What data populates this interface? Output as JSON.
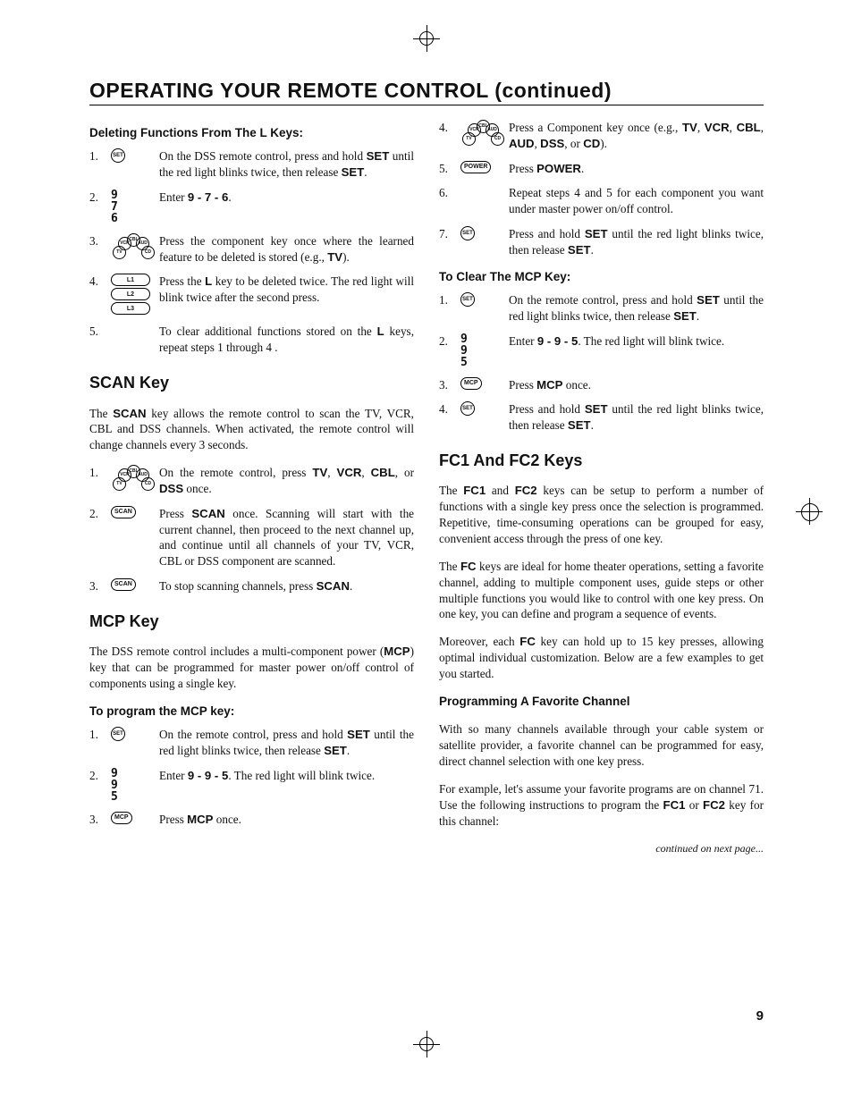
{
  "title": "OPERATING YOUR REMOTE CONTROL (continued)",
  "page_number": "9",
  "continued": "continued on next page...",
  "left": {
    "deleting_head": "Deleting Functions From The L Keys:",
    "del1_num": "1.",
    "del1_icon": "SET",
    "del1_text_a": "On the DSS remote control, press and hold ",
    "del1_text_b": " until the red light blinks twice, then release ",
    "del1_set": "SET",
    "del1_text_c": ".",
    "del2_num": "2.",
    "del2_digits": "9\n7\n6",
    "del2_text_a": "Enter ",
    "del2_code": "9 - 7 - 6",
    "del2_text_b": ".",
    "del3_num": "3.",
    "del3_text_a": "Press the component key once where the learned feature to be deleted is stored (e.g., ",
    "del3_tv": "TV",
    "del3_text_b": ").",
    "del4_num": "4.",
    "del4_l1": "L1",
    "del4_l2": "L2",
    "del4_l3": "L3",
    "del4_text_a": "Press the ",
    "del4_L": "L",
    "del4_text_b": " key to be deleted twice. The red light will blink twice after the second press.",
    "del5_num": "5.",
    "del5_text_a": "To clear additional functions stored on the ",
    "del5_L": "L",
    "del5_text_b": " keys, repeat steps 1 through 4 .",
    "scan_head": "SCAN Key",
    "scan_intro_a": "The ",
    "scan_intro_scan": "SCAN",
    "scan_intro_b": " key allows the remote control to scan the TV, VCR, CBL and DSS channels. When activated, the remote control will change channels every 3 seconds.",
    "scan1_num": "1.",
    "scan1_text_a": "On the remote control, press ",
    "scan1_tv": "TV",
    "scan1_text_b": ", ",
    "scan1_vcr": "VCR",
    "scan1_text_c": ", ",
    "scan1_cbl": "CBL",
    "scan1_text_d": ", or ",
    "scan1_dss": "DSS",
    "scan1_text_e": " once.",
    "scan2_num": "2.",
    "scan2_icon": "SCAN",
    "scan2_text_a": "Press ",
    "scan2_scan": "SCAN",
    "scan2_text_b": " once. Scanning will start with the current channel, then proceed to the next channel up, and continue until all channels of your TV, VCR, CBL or DSS component are scanned.",
    "scan3_num": "3.",
    "scan3_icon": "SCAN",
    "scan3_text_a": "To stop scanning channels, press ",
    "scan3_scan": "SCAN",
    "scan3_text_b": ".",
    "mcp_head": "MCP Key",
    "mcp_intro_a": "The DSS remote control includes a multi-component power (",
    "mcp_intro_mcp": "MCP",
    "mcp_intro_b": ") key that can be programmed for master power on/off control of components using a single key.",
    "mcp_prog_head": "To program the MCP key:",
    "mcp1_num": "1.",
    "mcp1_icon": "SET",
    "mcp1_text_a": "On the remote control, press and hold ",
    "mcp1_set": "SET",
    "mcp1_text_b": " until the red light blinks twice, then release ",
    "mcp1_set2": "SET",
    "mcp1_text_c": ".",
    "mcp2_num": "2.",
    "mcp2_digits": "9\n9\n5",
    "mcp2_text_a": "Enter ",
    "mcp2_code": "9 - 9 - 5",
    "mcp2_text_b": ". The red light will blink twice.",
    "mcp3_num": "3.",
    "mcp3_icon": "MCP",
    "mcp3_text_a": "Press ",
    "mcp3_mcp": "MCP",
    "mcp3_text_b": " once."
  },
  "right": {
    "r4_num": "4.",
    "r4_text_a": "Press a Component key once (e.g., ",
    "r4_tv": "TV",
    "r4_text_b": ", ",
    "r4_vcr": "VCR",
    "r4_text_c": ", ",
    "r4_cbl": "CBL",
    "r4_text_d": ", ",
    "r4_aud": "AUD",
    "r4_text_e": ", ",
    "r4_dss": "DSS",
    "r4_text_f": ", or ",
    "r4_cd": "CD",
    "r4_text_g": ").",
    "r5_num": "5.",
    "r5_icon": "POWER",
    "r5_text_a": "Press ",
    "r5_power": "POWER",
    "r5_text_b": ".",
    "r6_num": "6.",
    "r6_text": "Repeat steps 4 and 5 for each component you want under master power on/off control.",
    "r7_num": "7.",
    "r7_icon": "SET",
    "r7_text_a": "Press and hold ",
    "r7_set": "SET",
    "r7_text_b": " until the red light blinks twice, then release ",
    "r7_set2": "SET",
    "r7_text_c": ".",
    "clear_head": "To Clear The MCP Key:",
    "c1_num": "1.",
    "c1_icon": "SET",
    "c1_text_a": "On the remote control, press and hold ",
    "c1_set": "SET",
    "c1_text_b": " until the red light blinks twice, then release ",
    "c1_set2": "SET",
    "c1_text_c": ".",
    "c2_num": "2.",
    "c2_digits": "9\n9\n5",
    "c2_text_a": "Enter ",
    "c2_code": "9 - 9 - 5",
    "c2_text_b": ". The red light will blink twice.",
    "c3_num": "3.",
    "c3_icon": "MCP",
    "c3_text_a": "Press ",
    "c3_mcp": "MCP",
    "c3_text_b": " once.",
    "c4_num": "4.",
    "c4_icon": "SET",
    "c4_text_a": "Press and hold ",
    "c4_set": "SET",
    "c4_text_b": " until the red light blinks twice, then release ",
    "c4_set2": "SET",
    "c4_text_c": ".",
    "fc_head": "FC1 And FC2 Keys",
    "fc_p1_a": "The ",
    "fc_p1_fc1": "FC1",
    "fc_p1_b": " and ",
    "fc_p1_fc2": "FC2",
    "fc_p1_c": " keys can be setup to perform a number of functions with a single key press once the selection is programmed. Repetitive, time-consuming operations can be grouped for easy, convenient access through the press of  one key.",
    "fc_p2_a": "The ",
    "fc_p2_fc": "FC",
    "fc_p2_b": " keys are ideal for home theater operations, setting a favorite channel, adding to multiple component uses, guide steps or other multiple functions you would like to control with one key press. On one key, you can define and program a sequence of events.",
    "fc_p3_a": "Moreover, each ",
    "fc_p3_fc": "FC",
    "fc_p3_b": " key can hold up to 15 key presses, allowing optimal individual customization. Below are a few examples to get you started.",
    "fav_head": "Programming A Favorite Channel",
    "fav_p1": "With so many channels available through your cable system or satellite provider, a favorite channel can be programmed for easy, direct channel selection with one key press.",
    "fav_p2_a": "For example, let's assume your favorite programs are on channel 71. Use the following instructions to program the ",
    "fav_p2_fc1": "FC1",
    "fav_p2_b": " or ",
    "fav_p2_fc2": "FC2",
    "fav_p2_c": " key for  this channel:"
  },
  "arc_labels": {
    "a1": "TV",
    "a2": "VCR",
    "a3": "CBL",
    "a4": "AUD",
    "a5": "CD"
  }
}
